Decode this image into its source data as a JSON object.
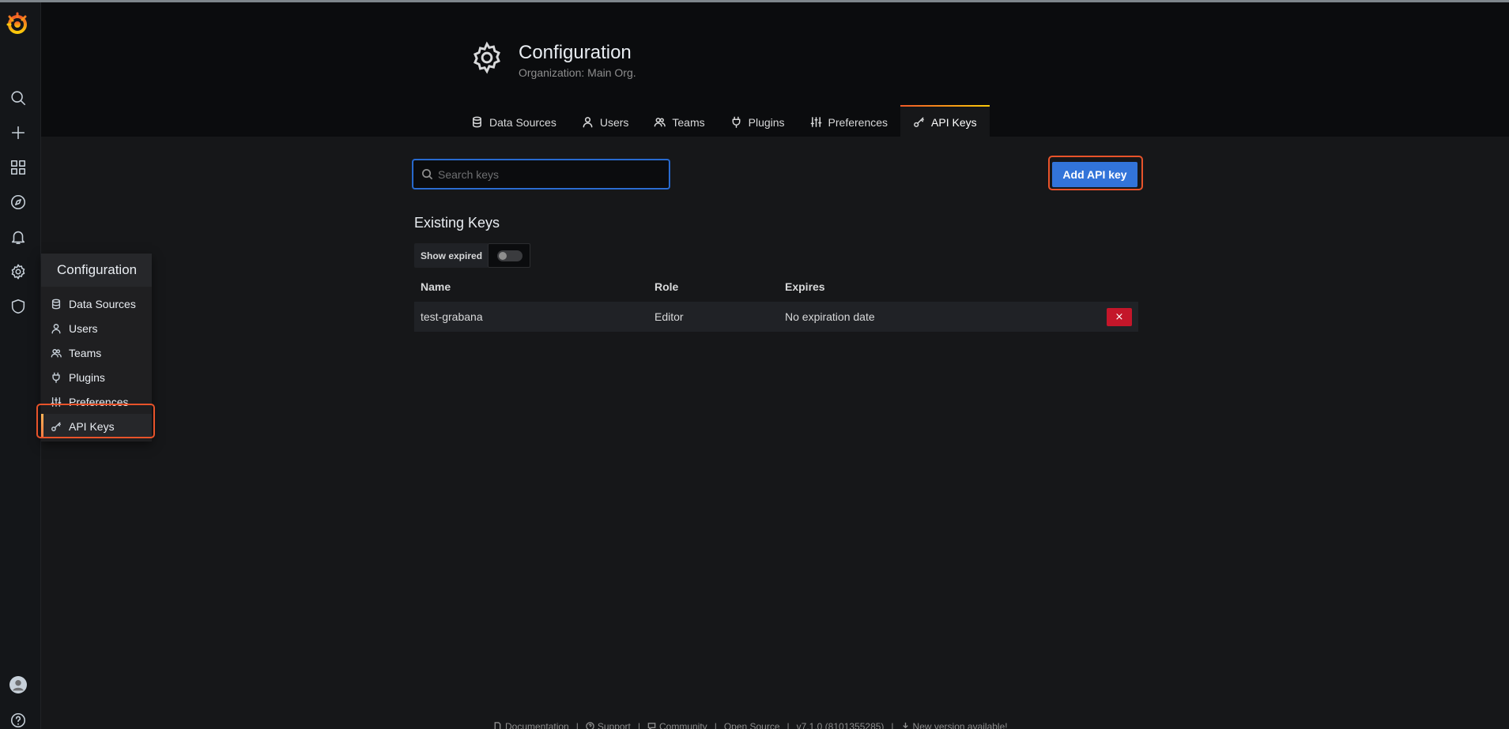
{
  "header": {
    "title": "Configuration",
    "subtitle": "Organization: Main Org."
  },
  "tabs": [
    {
      "label": "Data Sources",
      "icon": "database-icon"
    },
    {
      "label": "Users",
      "icon": "user-icon"
    },
    {
      "label": "Teams",
      "icon": "users-icon"
    },
    {
      "label": "Plugins",
      "icon": "plug-icon"
    },
    {
      "label": "Preferences",
      "icon": "sliders-icon"
    },
    {
      "label": "API Keys",
      "icon": "key-icon",
      "active": true
    }
  ],
  "submenu": {
    "title": "Configuration",
    "items": [
      {
        "label": "Data Sources"
      },
      {
        "label": "Users"
      },
      {
        "label": "Teams"
      },
      {
        "label": "Plugins"
      },
      {
        "label": "Preferences"
      },
      {
        "label": "API Keys",
        "active": true
      }
    ]
  },
  "toolbar": {
    "search_placeholder": "Search keys",
    "add_button": "Add API key"
  },
  "keys": {
    "section_title": "Existing Keys",
    "show_expired_label": "Show expired",
    "show_expired": false,
    "columns": [
      "Name",
      "Role",
      "Expires"
    ],
    "rows": [
      {
        "name": "test-grabana",
        "role": "Editor",
        "expires": "No expiration date"
      }
    ],
    "delete_label": "×"
  },
  "footer": {
    "items": [
      "Documentation",
      "Support",
      "Community",
      "Open Source",
      "v7.1.0 (8101355285)",
      "New version available!"
    ],
    "separator": "|"
  },
  "colors": {
    "primary": "#3274d9",
    "danger": "#c4162a",
    "highlight": "#e8532a",
    "background": "#161719"
  }
}
